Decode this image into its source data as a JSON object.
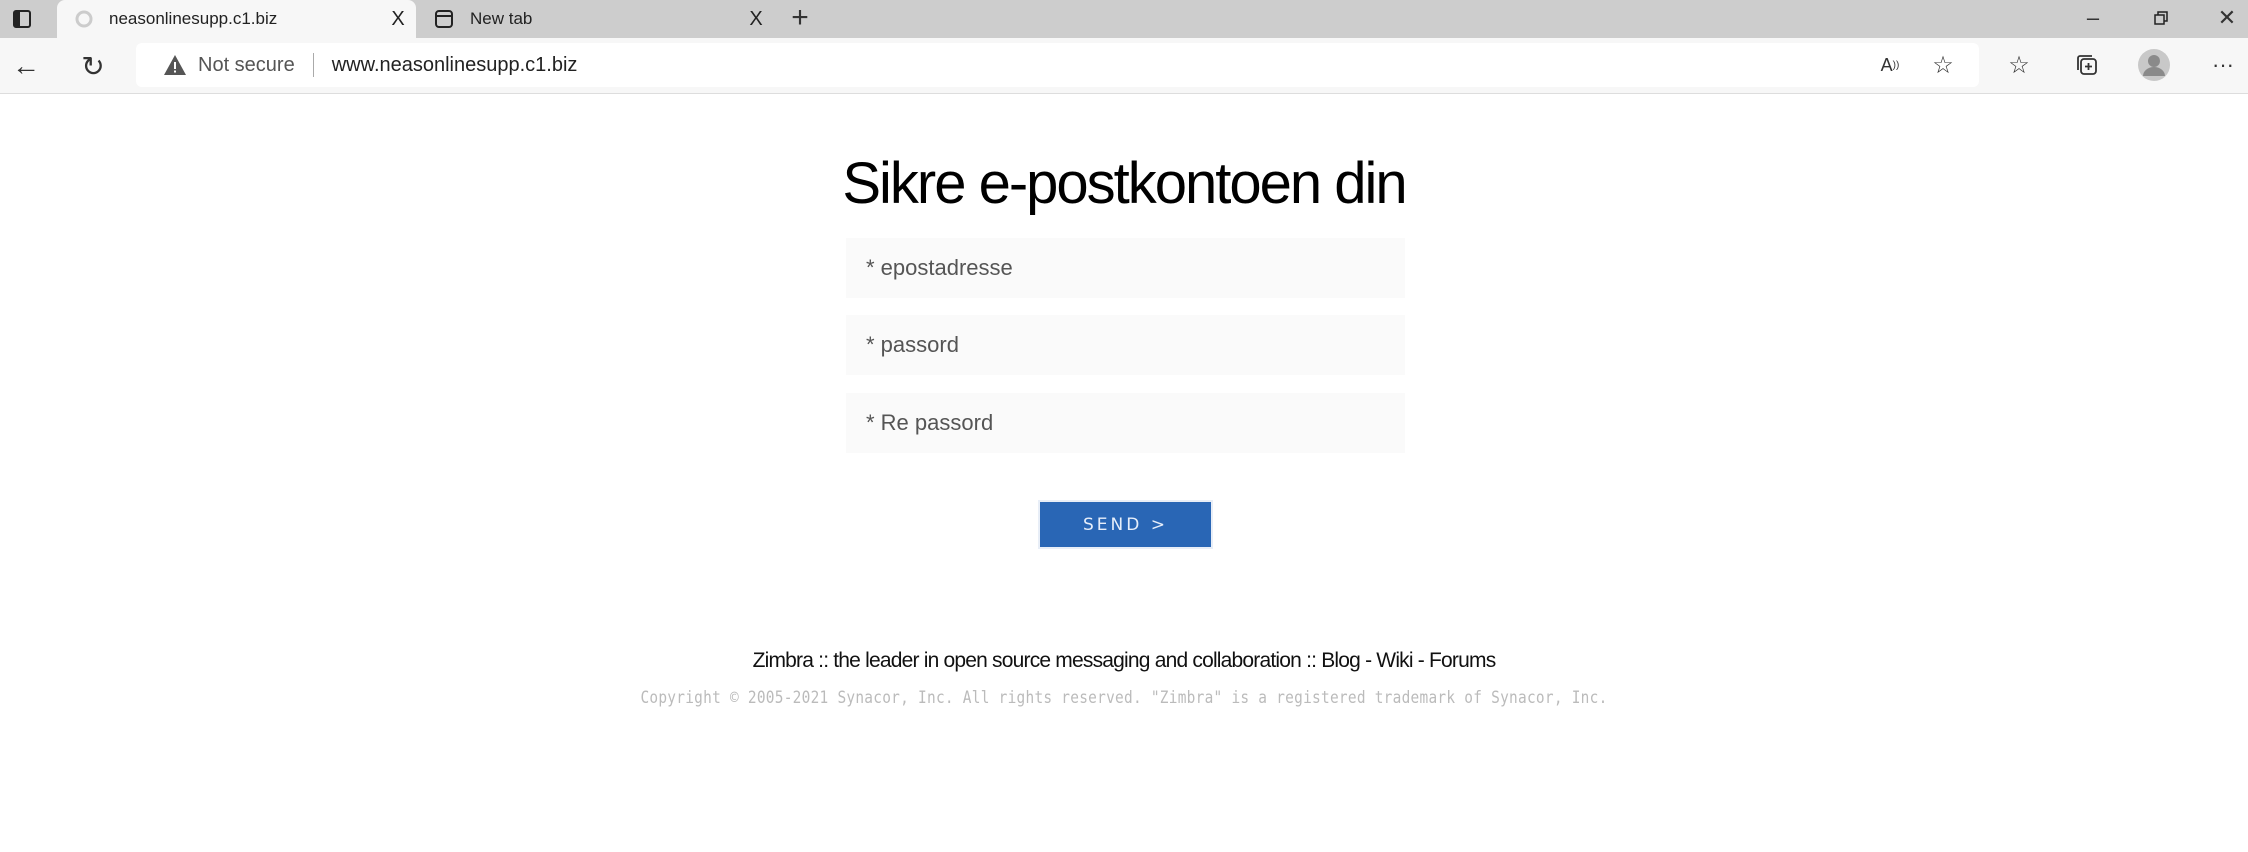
{
  "browser": {
    "tabs": [
      {
        "label": "neasonlinesupp.c1.biz",
        "active": true
      },
      {
        "label": "New tab",
        "active": false
      }
    ],
    "close_glyph": "X",
    "new_tab_glyph": "+",
    "security_label": "Not secure",
    "url": "www.neasonlinesupp.c1.biz",
    "icons": [
      "tab-actions-icon",
      "favicon-loading-icon",
      "new-tab-page-icon",
      "back-icon",
      "reload-icon",
      "warning-icon",
      "read-aloud-icon",
      "add-favorite-icon",
      "favorites-icon",
      "collections-icon",
      "profile-icon",
      "more-icon",
      "minimize-icon",
      "restore-icon",
      "close-icon"
    ]
  },
  "page": {
    "title": "Sikre e-postkontoen din",
    "fields": [
      {
        "placeholder": "* epostadresse",
        "value": ""
      },
      {
        "placeholder": "* passord",
        "value": ""
      },
      {
        "placeholder": "* Re passord",
        "value": ""
      }
    ],
    "submit_label": "SEND >",
    "footer": {
      "tagline": "Zimbra :: the leader in open source messaging and collaboration :: ",
      "links": [
        "Blog",
        "Wiki",
        "Forums"
      ],
      "separator": " - ",
      "copyright": "Copyright © 2005-2021 Synacor, Inc. All rights reserved. \"Zimbra\" is a registered trademark of Synacor, Inc."
    },
    "colors": {
      "button": "#2966b5",
      "copyright": "#bbbbbb"
    }
  }
}
